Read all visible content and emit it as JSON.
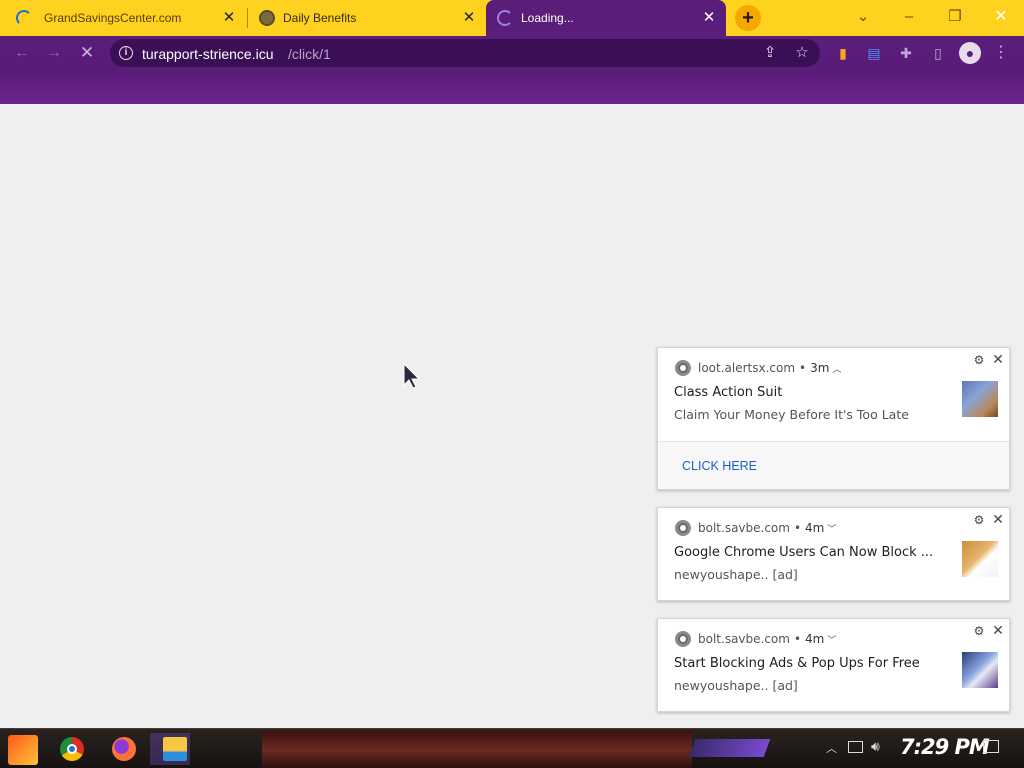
{
  "browser": {
    "tabs": [
      {
        "title": "GrandSavingsCenter.com",
        "active": false
      },
      {
        "title": "Daily Benefits",
        "active": false
      },
      {
        "title": "Loading...",
        "active": true
      }
    ],
    "new_tab_label": "+",
    "address_bar": {
      "host": "turapport-strience.icu",
      "path": "/click/1"
    },
    "theme_colors": {
      "tab_strip": "#ffd21f",
      "toolbar": "#5b1d7a",
      "active_tab": "#5b1d7a"
    }
  },
  "notifications": [
    {
      "origin": "loot.alertsx.com",
      "age": "3m",
      "title": "Class Action Suit",
      "body": "Claim Your Money Before It's Too Late",
      "action": "CLICK HERE",
      "thumbnail": "scales-of-justice-image"
    },
    {
      "origin": "bolt.savbe.com",
      "age": "4m",
      "title": "Google Chrome Users Can Now Block ...",
      "body": "newyoushape.. [ad]",
      "thumbnail": "hand-with-google-logo-image"
    },
    {
      "origin": "bolt.savbe.com",
      "age": "4m",
      "title": "Start Blocking Ads & Pop Ups For Free",
      "body": "newyoushape.. [ad]",
      "thumbnail": "abstract-blue-swirl-image"
    }
  ],
  "taskbar": {
    "pinned_apps": [
      "start-button",
      "chrome-icon",
      "firefox-icon",
      "file-explorer-icon"
    ],
    "clock": "7:29 PM"
  }
}
